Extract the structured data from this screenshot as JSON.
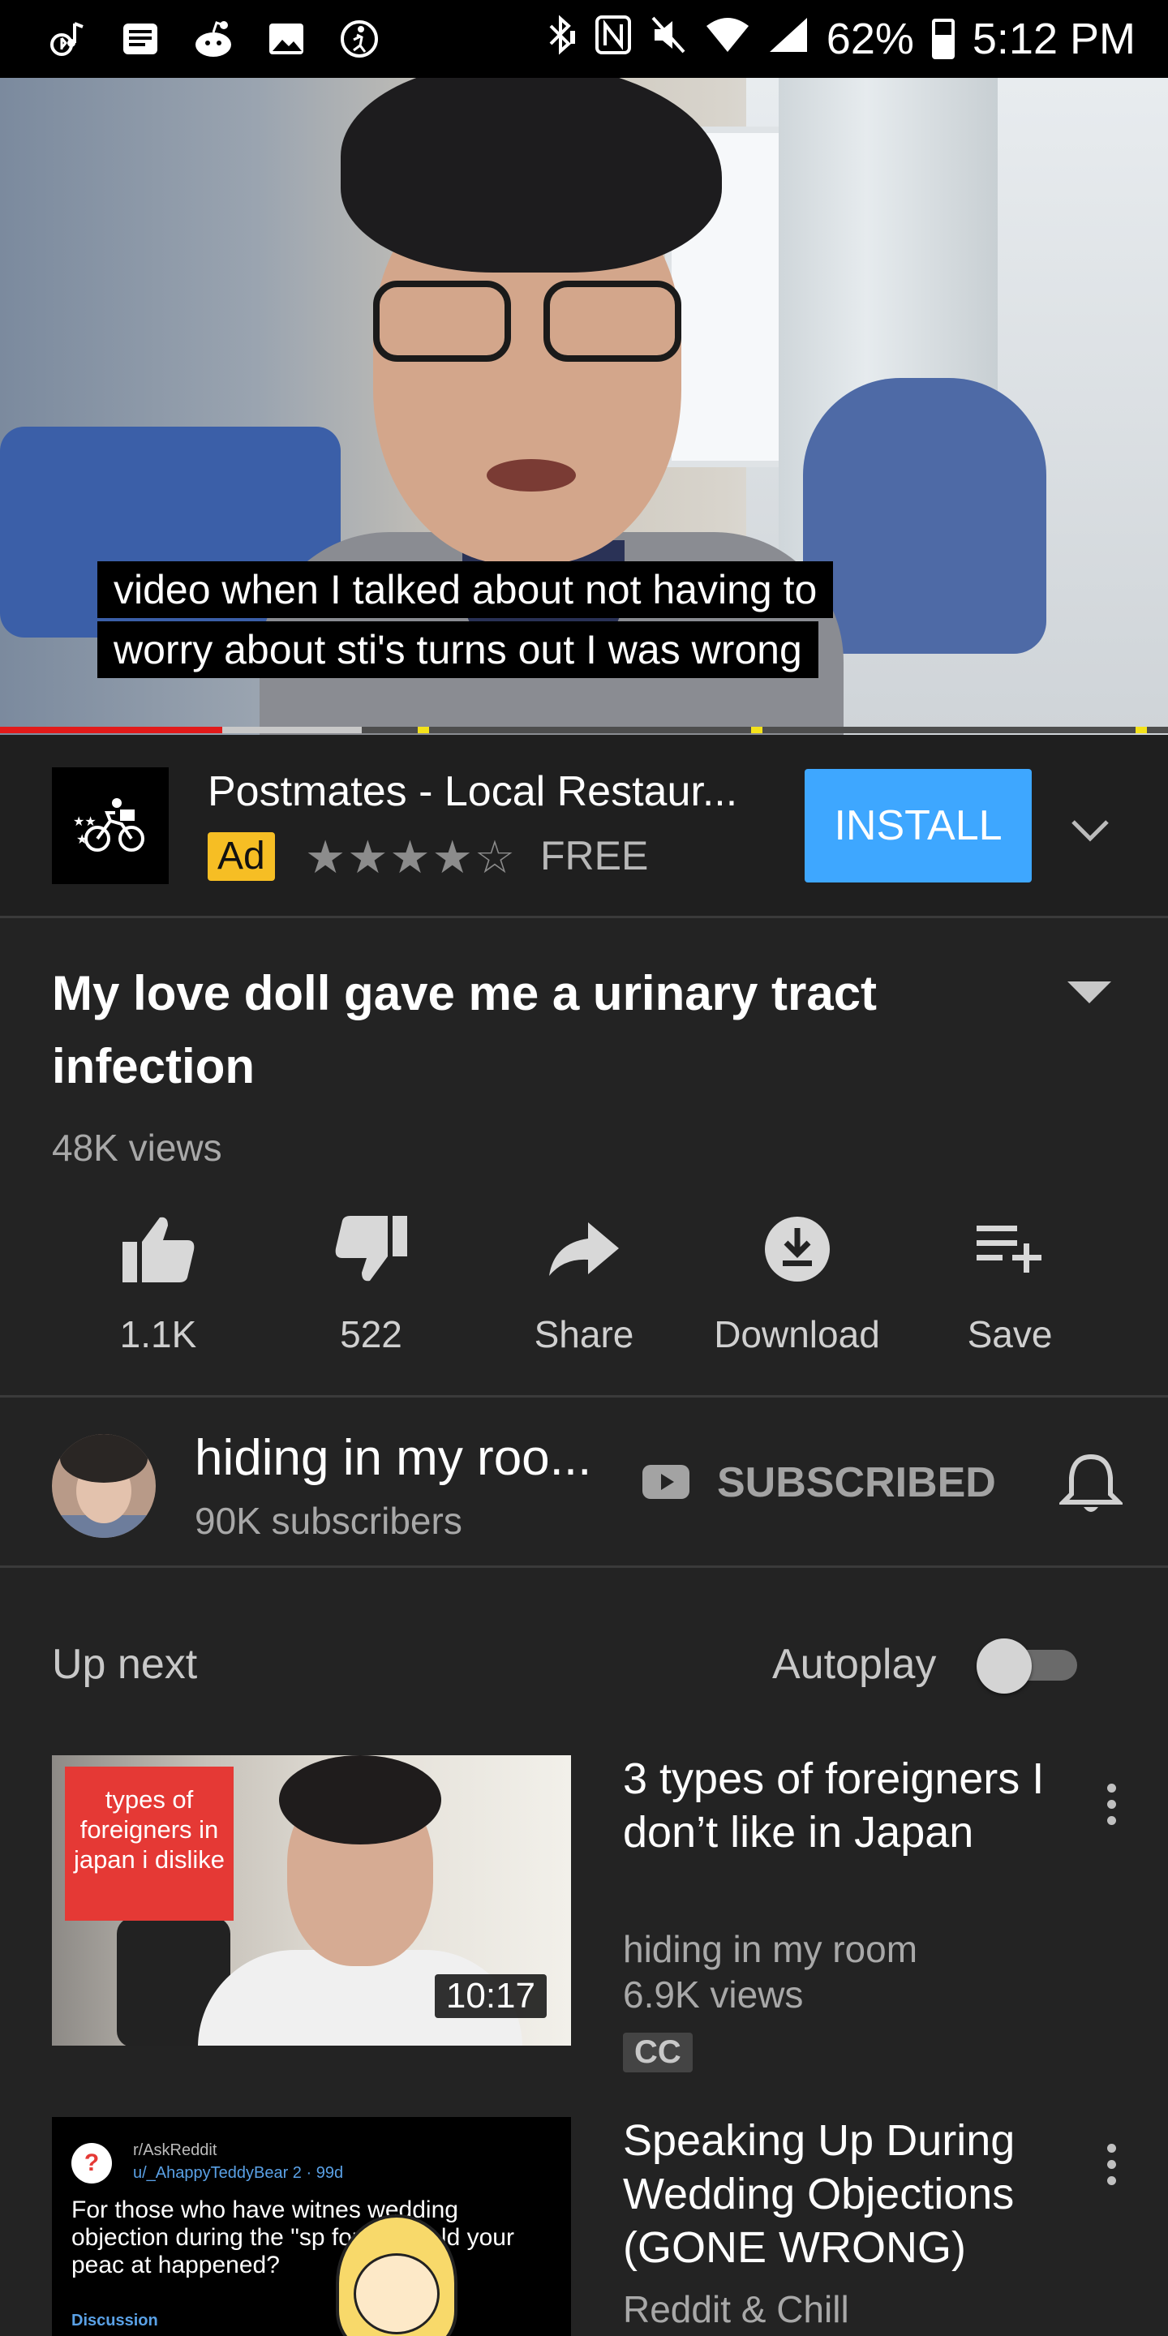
{
  "status_bar": {
    "battery": "62%",
    "time": "5:12 PM",
    "left_icons": [
      "bluetooth-music-icon",
      "news-icon",
      "reddit-icon",
      "gallery-icon",
      "accessibility-icon"
    ],
    "right_icons": [
      "bluetooth-icon",
      "nfc-icon",
      "mute-icon",
      "wifi-icon",
      "signal-icon"
    ]
  },
  "video": {
    "captions": [
      "video when I talked about not having to",
      "worry about sti's turns out I was wrong"
    ],
    "progress_played_fraction": 0.19,
    "progress_buffered_fraction": 0.31
  },
  "ad": {
    "title": "Postmates - Local Restaur...",
    "badge": "Ad",
    "rating_stars": 4,
    "stars": "★★★★☆",
    "price": "FREE",
    "install_label": "INSTALL"
  },
  "video_info": {
    "title": "My love doll gave me a urinary tract infection",
    "views": "48K views"
  },
  "actions": [
    {
      "label": "1.1K",
      "icon": "thumbs-up-icon"
    },
    {
      "label": "522",
      "icon": "thumbs-down-icon"
    },
    {
      "label": "Share",
      "icon": "share-icon"
    },
    {
      "label": "Download",
      "icon": "download-icon"
    },
    {
      "label": "Save",
      "icon": "playlist-add-icon"
    }
  ],
  "channel": {
    "name": "hiding in my roo...",
    "subscribers": "90K subscribers",
    "subscribed_label": "SUBSCRIBED"
  },
  "up_next": {
    "label": "Up next",
    "autoplay_label": "Autoplay",
    "autoplay_on": false
  },
  "videos": [
    {
      "thumb_text": "types of foreigners in japan i dislike",
      "duration": "10:17",
      "title": "3 types of foreigners I don’t like in Japan",
      "channel": "hiding in my room",
      "views": "6.9K views",
      "badge": "CC"
    },
    {
      "thumb_sub": "r/AskReddit",
      "thumb_user": "u/_AhappyTeddyBear  2 · 99d",
      "thumb_text": "For those who have witnes wedding objection during the \"sp forever hold your peac at happened?",
      "thumb_tag": "Discussion",
      "title": "Speaking Up During Wedding Objections (GONE WRONG)",
      "channel": "Reddit & Chill"
    }
  ],
  "colors": {
    "background": "#232323",
    "progress_red": "#e21a1a",
    "install_blue": "#3ea7ff",
    "ad_badge_yellow": "#f6be24"
  }
}
